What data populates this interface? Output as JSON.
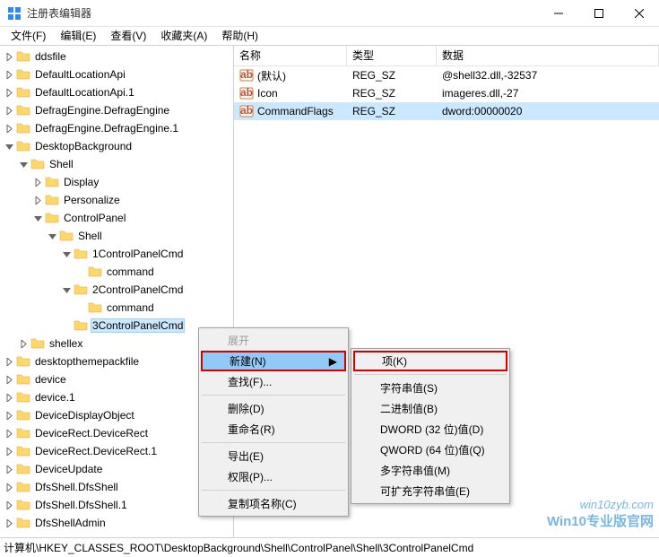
{
  "window": {
    "title": "注册表编辑器"
  },
  "menubar": [
    "文件(F)",
    "编辑(E)",
    "查看(V)",
    "收藏夹(A)",
    "帮助(H)"
  ],
  "tree": [
    {
      "l": "ddsfile",
      "indent": 0,
      "tw": "right"
    },
    {
      "l": "DefaultLocationApi",
      "indent": 0,
      "tw": "right"
    },
    {
      "l": "DefaultLocationApi.1",
      "indent": 0,
      "tw": "right"
    },
    {
      "l": "DefragEngine.DefragEngine",
      "indent": 0,
      "tw": "right"
    },
    {
      "l": "DefragEngine.DefragEngine.1",
      "indent": 0,
      "tw": "right"
    },
    {
      "l": "DesktopBackground",
      "indent": 0,
      "tw": "down"
    },
    {
      "l": "Shell",
      "indent": 1,
      "tw": "down"
    },
    {
      "l": "Display",
      "indent": 2,
      "tw": "right"
    },
    {
      "l": "Personalize",
      "indent": 2,
      "tw": "right"
    },
    {
      "l": "ControlPanel",
      "indent": 2,
      "tw": "down"
    },
    {
      "l": "Shell",
      "indent": 3,
      "tw": "down"
    },
    {
      "l": "1ControlPanelCmd",
      "indent": 4,
      "tw": "down"
    },
    {
      "l": "command",
      "indent": 5,
      "tw": "none"
    },
    {
      "l": "2ControlPanelCmd",
      "indent": 4,
      "tw": "down"
    },
    {
      "l": "command",
      "indent": 5,
      "tw": "none"
    },
    {
      "l": "3ControlPanelCmd",
      "indent": 4,
      "tw": "none",
      "sel": true
    },
    {
      "l": "shellex",
      "indent": 1,
      "tw": "right"
    },
    {
      "l": "desktopthemepackfile",
      "indent": 0,
      "tw": "right"
    },
    {
      "l": "device",
      "indent": 0,
      "tw": "right"
    },
    {
      "l": "device.1",
      "indent": 0,
      "tw": "right"
    },
    {
      "l": "DeviceDisplayObject",
      "indent": 0,
      "tw": "right"
    },
    {
      "l": "DeviceRect.DeviceRect",
      "indent": 0,
      "tw": "right"
    },
    {
      "l": "DeviceRect.DeviceRect.1",
      "indent": 0,
      "tw": "right"
    },
    {
      "l": "DeviceUpdate",
      "indent": 0,
      "tw": "right"
    },
    {
      "l": "DfsShell.DfsShell",
      "indent": 0,
      "tw": "right"
    },
    {
      "l": "DfsShell.DfsShell.1",
      "indent": 0,
      "tw": "right"
    },
    {
      "l": "DfsShellAdmin",
      "indent": 0,
      "tw": "right"
    }
  ],
  "columns": {
    "name": "名称",
    "type": "类型",
    "data": "数据"
  },
  "rows": [
    {
      "name": "(默认)",
      "type": "REG_SZ",
      "data": "@shell32.dll,-32537"
    },
    {
      "name": "Icon",
      "type": "REG_SZ",
      "data": "imageres.dll,-27"
    },
    {
      "name": "CommandFlags",
      "type": "REG_SZ",
      "data": "dword:00000020",
      "sel": true
    }
  ],
  "ctx1": {
    "expand": "展开",
    "new": "新建(N)",
    "find": "查找(F)...",
    "delete": "删除(D)",
    "rename": "重命名(R)",
    "export": "导出(E)",
    "perm": "权限(P)...",
    "copykey": "复制项名称(C)"
  },
  "ctx2": {
    "key": "项(K)",
    "string": "字符串值(S)",
    "binary": "二进制值(B)",
    "dword": "DWORD (32 位)值(D)",
    "qword": "QWORD (64 位)值(Q)",
    "multi": "多字符串值(M)",
    "expand": "可扩充字符串值(E)"
  },
  "statusbar": "计算机\\HKEY_CLASSES_ROOT\\DesktopBackground\\Shell\\ControlPanel\\Shell\\3ControlPanelCmd",
  "watermark": {
    "l1": "win10zyb.com",
    "l2": "Win10专业版官网"
  }
}
